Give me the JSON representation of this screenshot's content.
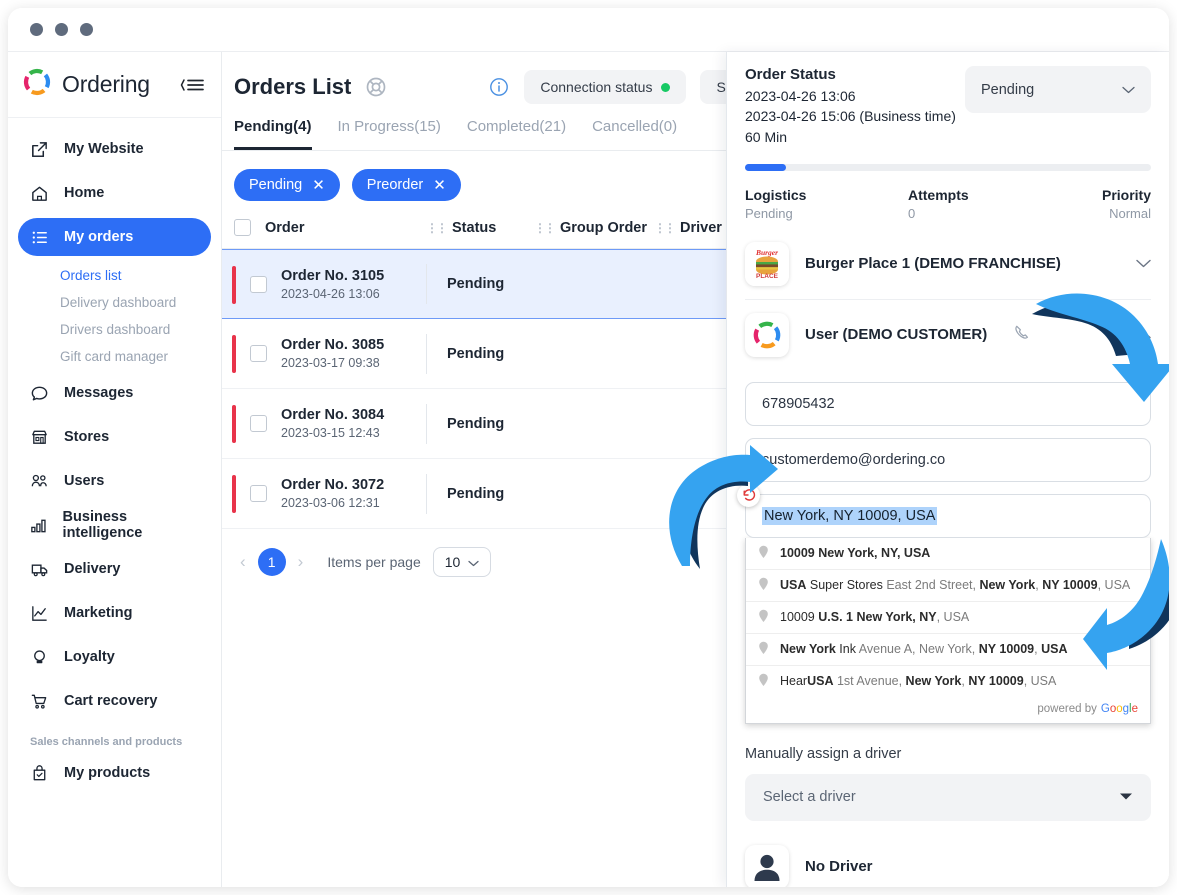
{
  "window": {
    "dots": 3
  },
  "sidebar": {
    "brand": "Ordering",
    "collapse_icon": "collapse-menu-icon",
    "items": [
      {
        "label": "My Website",
        "icon": "external-link-icon"
      },
      {
        "label": "Home",
        "icon": "home-icon"
      },
      {
        "label": "My orders",
        "icon": "list-icon",
        "active": true
      }
    ],
    "sub_items": [
      {
        "label": "Orders list",
        "active": true
      },
      {
        "label": "Delivery dashboard",
        "active": false
      },
      {
        "label": "Drivers dashboard",
        "active": false
      },
      {
        "label": "Gift card manager",
        "active": false
      }
    ],
    "items2": [
      {
        "label": "Messages",
        "icon": "chat-icon"
      },
      {
        "label": "Stores",
        "icon": "store-icon"
      },
      {
        "label": "Users",
        "icon": "users-icon"
      },
      {
        "label": "Business intelligence",
        "icon": "bar-chart-icon"
      },
      {
        "label": "Delivery",
        "icon": "truck-icon"
      },
      {
        "label": "Marketing",
        "icon": "line-chart-icon"
      },
      {
        "label": "Loyalty",
        "icon": "loyalty-icon"
      },
      {
        "label": "Cart recovery",
        "icon": "cart-icon"
      }
    ],
    "section_label": "Sales channels and products",
    "items3": [
      {
        "label": "My products",
        "icon": "bag-check-icon"
      }
    ]
  },
  "main": {
    "page_title": "Orders List",
    "title_icon": "lifebuoy-icon",
    "info_icon": "info-icon",
    "connection_status": "Connection status",
    "connection_dot_color": "#17c964",
    "sla_button": "SLA's se",
    "tabs": [
      {
        "label": "Pending(4)",
        "active": true
      },
      {
        "label": "In Progress(15)",
        "active": false
      },
      {
        "label": "Completed(21)",
        "active": false
      },
      {
        "label": "Cancelled(0)",
        "active": false
      }
    ],
    "filter_pills": [
      {
        "label": "Pending"
      },
      {
        "label": "Preorder"
      }
    ],
    "table": {
      "columns": [
        "Order",
        "Status",
        "Group Order",
        "Driver Gro"
      ],
      "rows": [
        {
          "order_no": "Order No. 3105",
          "datetime": "2023-04-26 13:06",
          "status": "Pending",
          "selected": true
        },
        {
          "order_no": "Order No. 3085",
          "datetime": "2023-03-17 09:38",
          "status": "Pending",
          "selected": false
        },
        {
          "order_no": "Order No. 3084",
          "datetime": "2023-03-15 12:43",
          "status": "Pending",
          "selected": false
        },
        {
          "order_no": "Order No. 3072",
          "datetime": "2023-03-06 12:31",
          "status": "Pending",
          "selected": false
        }
      ]
    },
    "pagination": {
      "prev": "‹",
      "page": "1",
      "next": "›",
      "items_per_page_label": "Items per page",
      "items_per_page_value": "10"
    }
  },
  "panel": {
    "order_status_title": "Order Status",
    "created_at": "2023-04-26 13:06",
    "business_time": "2023-04-26 15:06 (Business time)",
    "duration": "60 Min",
    "status_value": "Pending",
    "progress_percent": 10,
    "metrics": [
      {
        "key": "Logistics",
        "value": "Pending"
      },
      {
        "key": "Attempts",
        "value": "0"
      },
      {
        "key": "Priority",
        "value": "Normal"
      }
    ],
    "business": {
      "name": "Burger Place 1 (DEMO FRANCHISE)",
      "thumb": "burger-place-logo"
    },
    "customer": {
      "name": "User (DEMO CUSTOMER)",
      "thumb": "ordering-logo",
      "phone_icon": "phone-icon",
      "edit_icon": "pencil-icon"
    },
    "fields": {
      "phone": "678905432",
      "email": "customerdemo@ordering.co",
      "address": "New York, NY 10009, USA"
    },
    "autocomplete": {
      "items": [
        {
          "main": "10009",
          "main_bold": true,
          "rest": " New York, NY, USA",
          "rest_bold_parts": "New York, NY, USA"
        },
        {
          "main": "USA",
          "rest": " Super Stores East 2nd Street, New York, NY 10009, USA"
        },
        {
          "main": "10009",
          "rest": " U.S. 1 New York, NY, USA"
        },
        {
          "main": "New York",
          "rest": " Ink Avenue A, New York, NY 10009, USA"
        },
        {
          "main": "Hear",
          "rest": "USA 1st Avenue, New York, NY 10009, USA"
        }
      ],
      "footer": "powered by",
      "google": "Google"
    },
    "assign_label": "Manually assign a driver",
    "driver_select": "Select a driver",
    "no_driver": "No Driver"
  }
}
